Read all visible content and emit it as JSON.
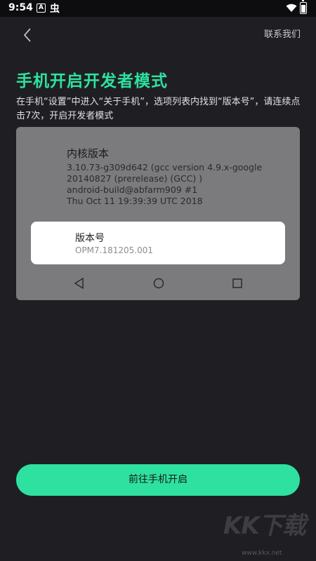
{
  "status_bar": {
    "time": "9:54",
    "icons": [
      "a-box-icon",
      "bug-icon",
      "wifi-icon",
      "battery-icon"
    ]
  },
  "header": {
    "contact_label": "联系我们"
  },
  "page": {
    "title": "手机开启开发者模式",
    "description": "在手机“设置”中进入“关于手机”，选项列表内找到“版本号”，请连续点击7次，开启开发者模式"
  },
  "phone_mock": {
    "kernel_title": "内核版本",
    "kernel_lines": [
      "3.10.73-g309d642 (gcc version 4.9.x-google",
      "20140827 (prerelease) (GCC) )",
      "android-build@abfarm909 #1",
      "Thu Oct 11 19:39:39 UTC 2018"
    ],
    "build_title": "版本号",
    "build_value": "OPM7.181205.001"
  },
  "cta": {
    "label": "前往手机开启"
  },
  "watermark": {
    "logo_text": "KK下载",
    "url": "www.kkx.net"
  },
  "colors": {
    "accent": "#2ee1a1",
    "background": "#1f1f23",
    "mock_background": "#7b7b7e"
  }
}
